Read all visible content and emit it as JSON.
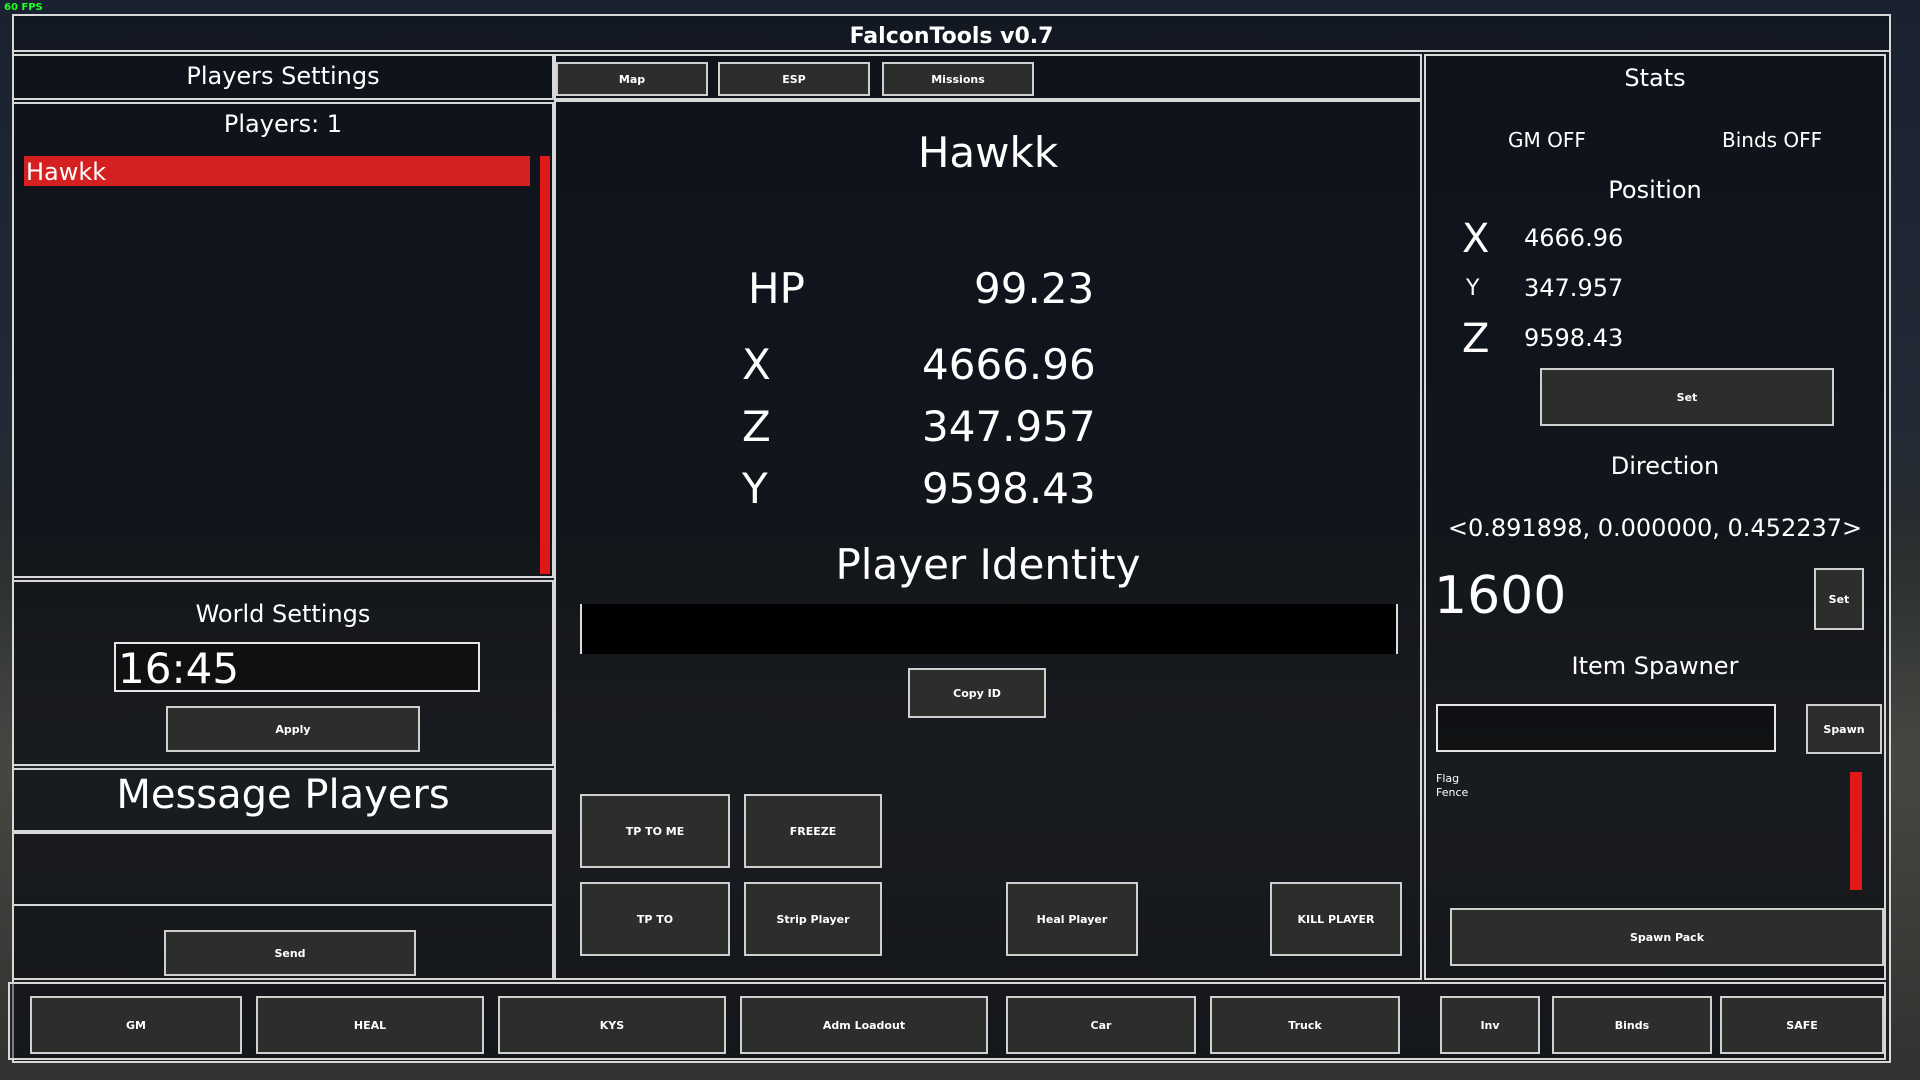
{
  "fps": "60 FPS",
  "app_title": "FalconTools v0.7",
  "players": {
    "header": "Players Settings",
    "count_label": "Players: 1",
    "list": [
      "Hawkk"
    ]
  },
  "tabs": [
    "Map",
    "ESP",
    "Missions"
  ],
  "player_detail": {
    "name": "Hawkk",
    "rows": [
      {
        "label": "HP",
        "value": "99.23"
      },
      {
        "label": "X",
        "value": "4666.96"
      },
      {
        "label": "Z",
        "value": "347.957"
      },
      {
        "label": "Y",
        "value": "9598.43"
      }
    ],
    "identity_header": "Player Identity",
    "copy_id_label": "Copy ID",
    "actions": {
      "tp_to_me": "TP TO ME",
      "freeze": "FREEZE",
      "tp_to": "TP TO",
      "strip": "Strip Player",
      "heal": "Heal Player",
      "kill": "KILL PLAYER"
    }
  },
  "world": {
    "header": "World Settings",
    "time_value": "16:45",
    "apply_label": "Apply"
  },
  "message": {
    "header": "Message Players",
    "send_label": "Send"
  },
  "stats": {
    "header": "Stats",
    "gm_status": "GM OFF",
    "binds_status": "Binds OFF",
    "position_header": "Position",
    "position": [
      {
        "axis": "X",
        "value": "4666.96"
      },
      {
        "axis": "Y",
        "value": "347.957"
      },
      {
        "axis": "Z",
        "value": "9598.43"
      }
    ],
    "set_label": "Set",
    "direction_header": "Direction",
    "direction_value": "<0.891898, 0.000000, 0.452237>",
    "distance_value": "1600",
    "distance_set_label": "Set",
    "item_spawner_header": "Item Spawner",
    "spawn_label": "Spawn",
    "spawn_items": [
      "Flag",
      "Fence"
    ],
    "spawn_pack_label": "Spawn Pack"
  },
  "bottom_bar": [
    "GM",
    "HEAL",
    "KYS",
    "Adm Loadout",
    "Car",
    "Truck",
    "Inv",
    "Binds",
    "SAFE"
  ],
  "colors": {
    "accent_red": "#d42020",
    "border": "#d8d8d8",
    "button_bg": "#2c2e2c"
  }
}
